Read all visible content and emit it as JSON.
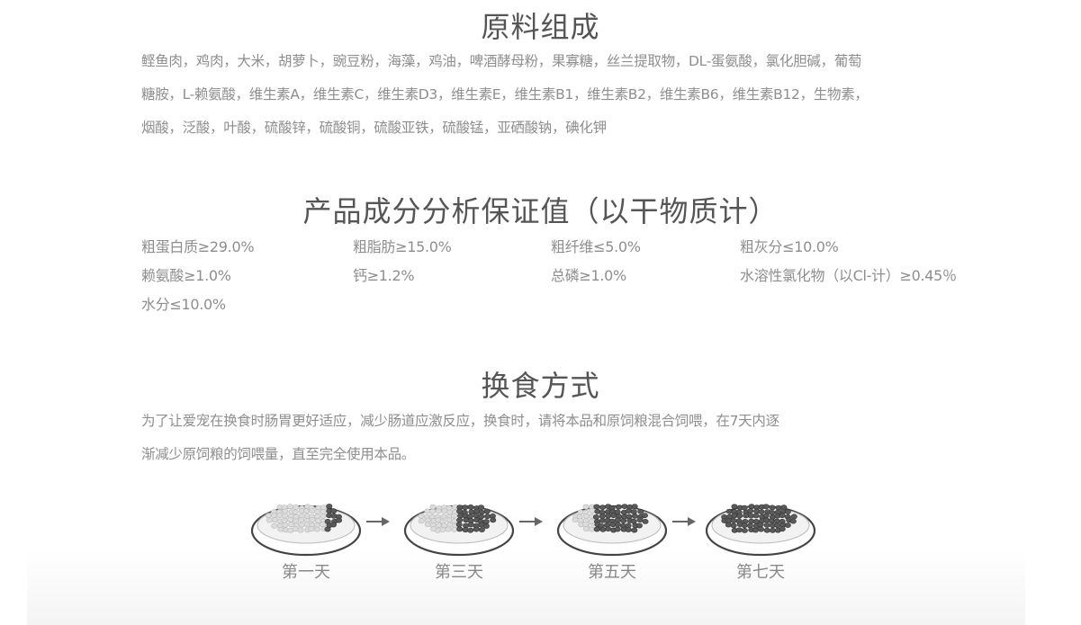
{
  "ingredients": {
    "title": "原料组成",
    "lines": [
      "鲣鱼肉，鸡肉，大米，胡萝卜，豌豆粉，海藻，鸡油，啤酒酵母粉，果寡糖，丝兰提取物，DL-蛋氨酸，氯化胆碱，葡萄",
      "糖胺，L-赖氨酸，维生素A，维生素C，维生素D3，维生素E，维生素B1，维生素B2，维生素B6，维生素B12，生物素，",
      "烟酸，泛酸，叶酸，硫酸锌，硫酸铜，硫酸亚铁，硫酸锰，亚硒酸钠，碘化钾"
    ]
  },
  "analysis": {
    "title": "产品成分分析保证值（以干物质计）",
    "rows": [
      [
        "粗蛋白质≥29.0%",
        "粗脂肪≥15.0%",
        "粗纤维≤5.0%",
        "粗灰分≤10.0%"
      ],
      [
        "赖氨酸≥1.0%",
        "钙≥1.2%",
        "总磷≥1.0%",
        "水溶性氯化物（以Cl-计）≥0.45％"
      ],
      [
        "水分≤10.0%",
        "",
        "",
        ""
      ]
    ]
  },
  "transition": {
    "title": "换食方式",
    "lines": [
      "为了让爱宠在换食时肠胃更好适应，减少肠道应激反应，换食时，请将本品和原饲粮混合饲喂，在7天内逐",
      "渐减少原饲粮的饲喂量，直至完全使用本品。"
    ],
    "steps": [
      {
        "label": "第一天",
        "new_food_fraction": 0.25
      },
      {
        "label": "第三天",
        "new_food_fraction": 0.5
      },
      {
        "label": "第五天",
        "new_food_fraction": 0.75
      },
      {
        "label": "第七天",
        "new_food_fraction": 1.0
      }
    ]
  },
  "colors": {
    "old_food": "#dcdcdc",
    "new_food": "#5a5a5a",
    "title": "#555555",
    "body_text": "#8e8e8e"
  }
}
